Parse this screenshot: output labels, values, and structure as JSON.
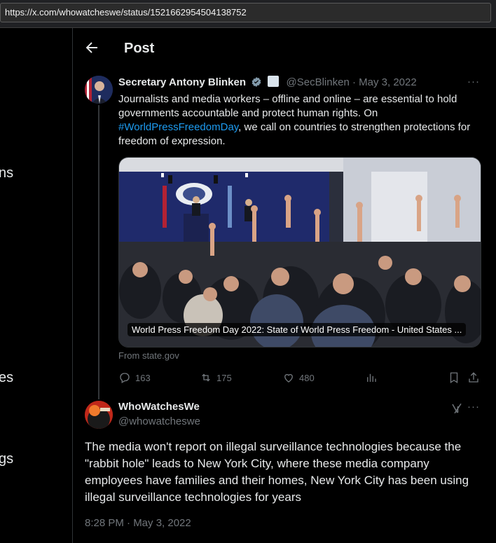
{
  "browser": {
    "url": "https://x.com/whowatcheswe/status/1521662954504138752"
  },
  "leftnav": {
    "fragments": [
      "ns",
      "es",
      "gs"
    ]
  },
  "header": {
    "title": "Post"
  },
  "tweet": {
    "author_name": "Secretary Antony Blinken",
    "handle": "@SecBlinken",
    "separator": "·",
    "date": "May 3, 2022",
    "text_part1": "Journalists and media workers – offline and online – are essential to hold governments accountable and protect human rights. On ",
    "hashtag": "#WorldPressFreedomDay",
    "text_part2": ", we call on countries to strengthen protections for freedom of expression.",
    "more": "···",
    "card_caption": "World Press Freedom Day 2022: State of World Press Freedom - United States ...",
    "card_source": "From state.gov",
    "stats": {
      "replies": "163",
      "reposts": "175",
      "likes": "480"
    }
  },
  "reply": {
    "author_name": "WhoWatchesWe",
    "handle": "@whowatcheswe",
    "more": "···",
    "text": "The media won't report on illegal surveillance technologies because the \"rabbit hole\" leads to New York City, where these media company employees have families and their homes, New York City has been using illegal surveillance technologies for years",
    "time": "8:28 PM · May 3, 2022"
  },
  "icons": [
    "back-arrow-icon",
    "verified-badge-icon",
    "gov-badge-icon",
    "more-icon",
    "reply-icon",
    "repost-icon",
    "like-icon",
    "views-icon",
    "bookmark-icon",
    "share-icon",
    "grok-icon"
  ],
  "colors": {
    "accent": "#1d9bf0",
    "text": "#e7e9ea",
    "muted": "#71767b",
    "border": "#2f3336",
    "background": "#000000"
  }
}
